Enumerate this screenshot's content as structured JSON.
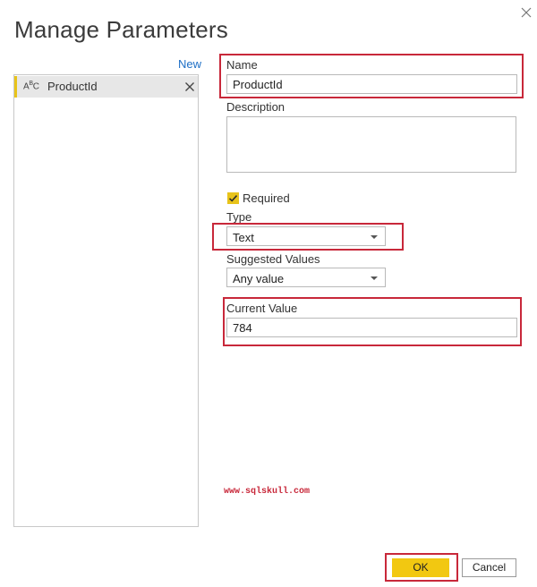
{
  "dialog": {
    "title": "Manage Parameters"
  },
  "sidebar": {
    "new_label": "New",
    "items": [
      {
        "type_icon": "ABC",
        "name": "ProductId"
      }
    ]
  },
  "form": {
    "name_label": "Name",
    "name_value": "ProductId",
    "description_label": "Description",
    "description_value": "",
    "required_label": "Required",
    "required_checked": true,
    "type_label": "Type",
    "type_value": "Text",
    "suggested_label": "Suggested Values",
    "suggested_value": "Any value",
    "current_label": "Current Value",
    "current_value": "784"
  },
  "watermark": "www.sqlskull.com",
  "footer": {
    "ok_label": "OK",
    "cancel_label": "Cancel"
  },
  "colors": {
    "accent": "#e8c31a",
    "highlight": "#c8283a",
    "link": "#1e6fc6"
  }
}
